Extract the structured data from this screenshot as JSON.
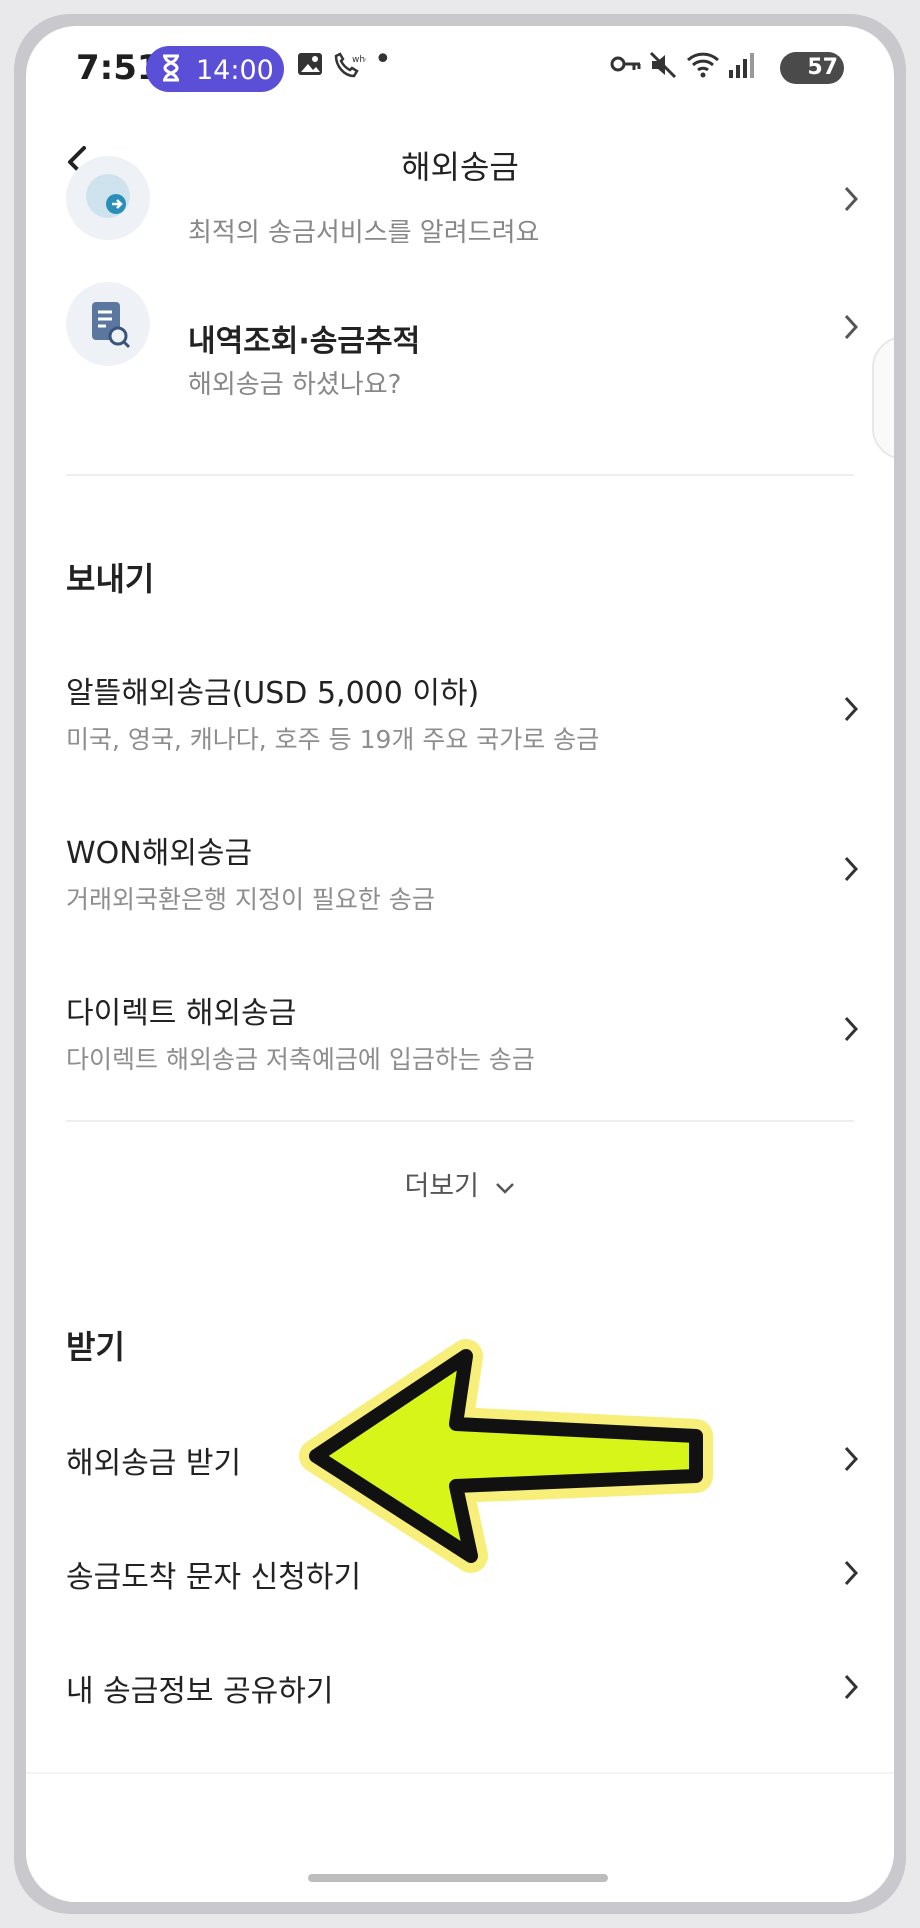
{
  "status_bar": {
    "time": "7:51",
    "timer": "14:00",
    "battery": "57"
  },
  "header": {
    "title": "해외송금"
  },
  "top_items": [
    {
      "subtitle": "최적의 송금서비스를 알려드려요"
    },
    {
      "title": "내역조회·송금추적",
      "subtitle": "해외송금 하셨나요?"
    }
  ],
  "send_section": {
    "title": "보내기",
    "items": [
      {
        "title": "알뜰해외송금(USD 5,000 이하)",
        "subtitle": "미국, 영국, 캐나다, 호주 등 19개 주요 국가로 송금"
      },
      {
        "title": "WON해외송금",
        "subtitle": "거래외국환은행 지정이 필요한 송금"
      },
      {
        "title": "다이렉트 해외송금",
        "subtitle": "다이렉트 해외송금 저축예금에 입금하는 송금"
      }
    ],
    "more_label": "더보기"
  },
  "receive_section": {
    "title": "받기",
    "items": [
      {
        "title": "해외송금 받기"
      },
      {
        "title": "송금도착 문자 신청하기"
      },
      {
        "title": "내 송금정보 공유하기"
      }
    ]
  },
  "colors": {
    "accent_purple": "#5b4fd8",
    "annotation_arrow": "#d8f51a",
    "annotation_outline": "#111111",
    "annotation_glow": "#f7ef7a"
  }
}
